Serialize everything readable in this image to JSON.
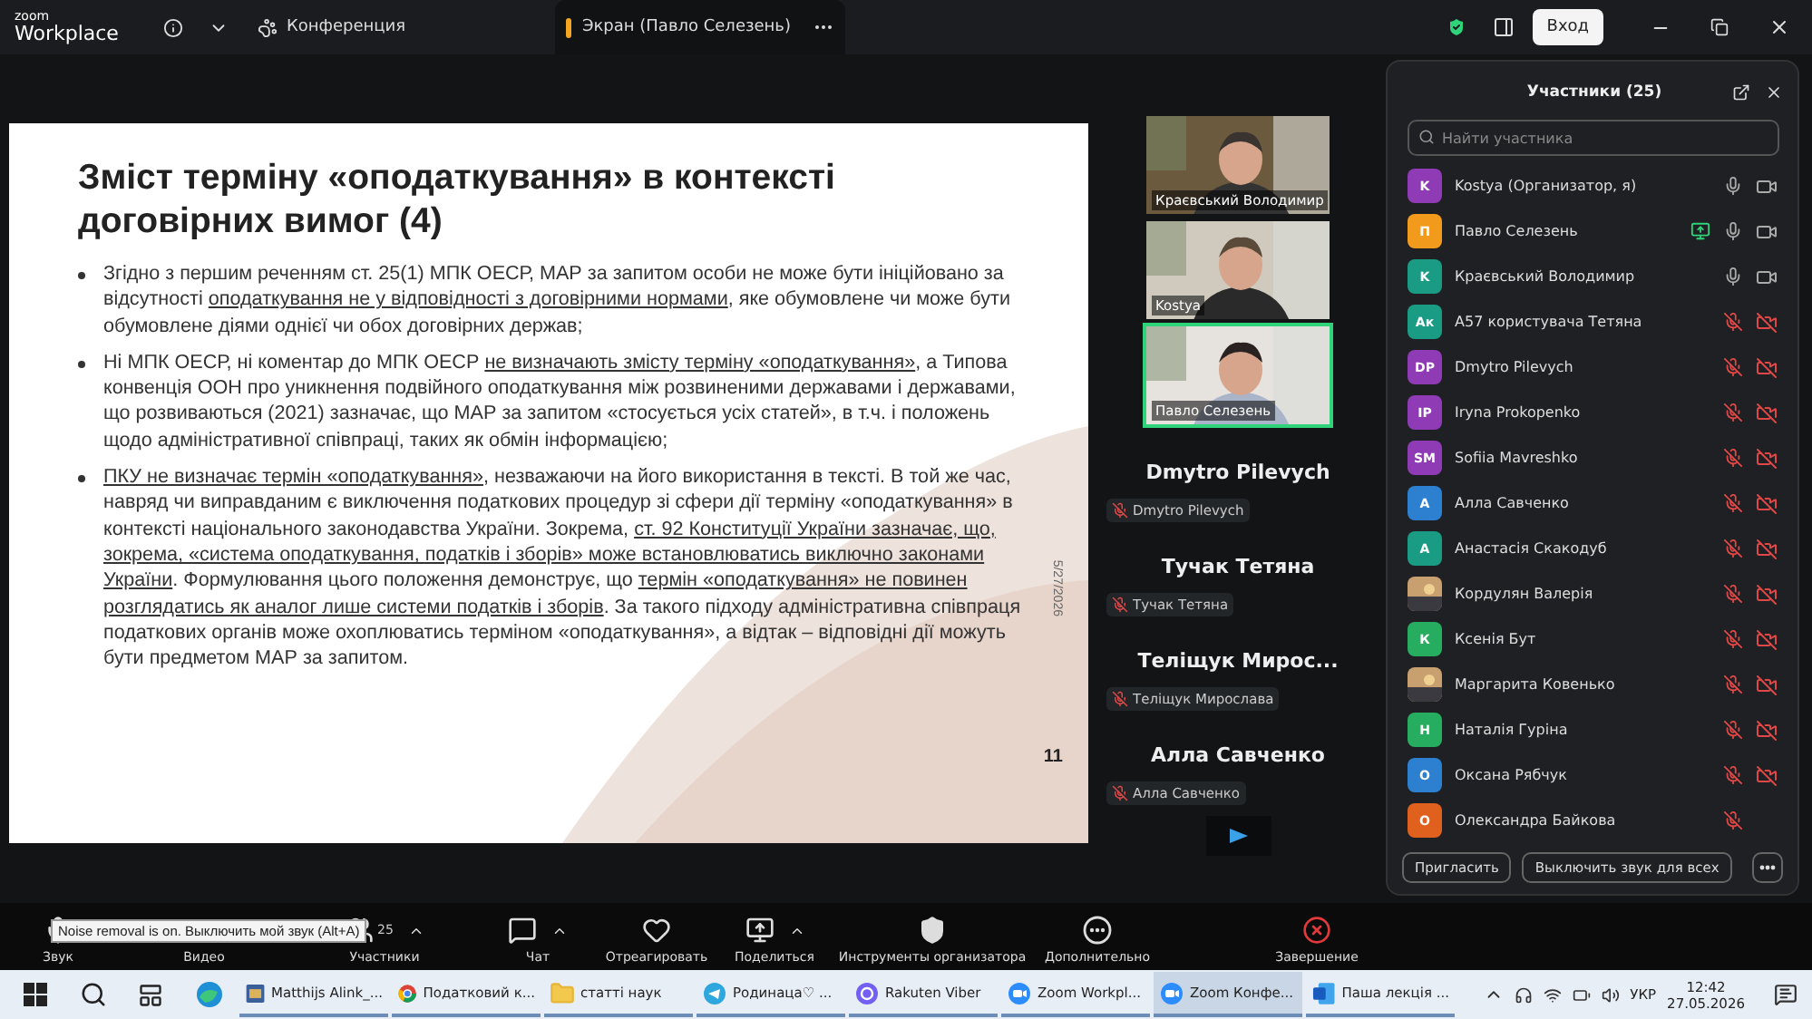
{
  "top_bar": {
    "logo_top": "zoom",
    "logo_bottom": "Workplace",
    "meeting_label": "Конференция",
    "share_tab": "Экран (Павло Селезень)",
    "login_button": "Вход"
  },
  "slide": {
    "title": "Зміст терміну «оподаткування» в контексті договірних вимог (4)",
    "bullets": [
      [
        {
          "text": "Згідно з першим реченням ст. 25(1) МПК ОЕСР, МАР за запитом особи не може бути ініційовано за відсутності ",
          "underlined": false
        },
        {
          "text": "оподаткування не у відповідності з договірними нормами",
          "underlined": true
        },
        {
          "text": ", яке обумовлене чи може бути обумовлене діями однієї чи обох договірних держав;",
          "underlined": false
        }
      ],
      [
        {
          "text": "Ні МПК ОЕСР, ні коментар до МПК ОЕСР ",
          "underlined": false
        },
        {
          "text": "не визначають змісту терміну «оподаткування»",
          "underlined": true
        },
        {
          "text": ", а Типова конвенція ООН про уникнення подвійного оподаткування між розвиненими державами і державами, що розвиваються (2021) зазначає, що МАР за запитом «стосується усіх статей», в т.ч. і положень щодо адміністративної співпраці, таких як обмін інформацією;",
          "underlined": false
        }
      ],
      [
        {
          "text": "ПКУ не визначає термін «оподаткування»",
          "underlined": true
        },
        {
          "text": ", незважаючи на його використання в тексті. В той же час, навряд чи виправданим є виключення податкових процедур зі сфери дії терміну «оподаткування» в контексті національного законодавства України. Зокрема, ",
          "underlined": false
        },
        {
          "text": "ст. 92 Конституції України зазначає, що, зокрема, «система оподаткування, податків і зборів» може встановлюватись виключно законами України",
          "underlined": true
        },
        {
          "text": ". Формулювання цього положення демонструє, що ",
          "underlined": false
        },
        {
          "text": "термін «оподаткування» не повинен розглядатись як аналог лише системи податків і зборів",
          "underlined": true
        },
        {
          "text": ". За такого підходу адміністративна співпраця податкових органів може охоплюватись терміном «оподаткування», а відтак – відповідні дії можуть бути предметом МАР за запитом.",
          "underlined": false
        }
      ]
    ],
    "side_date": "5/27/2026",
    "page_number": "11"
  },
  "video_tiles": [
    {
      "name": "Краєвський Володимир",
      "speaking": false
    },
    {
      "name": "Kostya",
      "speaking": false
    },
    {
      "name": "Павло Селезень",
      "speaking": true
    }
  ],
  "name_cards": [
    {
      "title": "Dmytro Pilevych",
      "tag": "Dmytro Pilevych"
    },
    {
      "title": "Тучак Тетяна",
      "tag": "Тучак Тетяна"
    },
    {
      "title": "Теліщук  Мирос...",
      "tag": "Теліщук Мирослава"
    },
    {
      "title": "Алла Савченко",
      "tag": "Алла Савченко"
    }
  ],
  "participants": {
    "title": "Участники (25)",
    "search": {
      "placeholder": "Найти участника"
    },
    "rows": [
      {
        "initials": "K",
        "name": "Kostya (Организатор, я)",
        "color": "#8e3bb5",
        "kind": "letter",
        "sharing": false,
        "muted": false,
        "video_shown": true,
        "video_muted": false
      },
      {
        "initials": "П",
        "name": "Павло Селезень",
        "color": "#f29a1c",
        "kind": "letter",
        "sharing": true,
        "muted": false,
        "video_shown": true,
        "video_muted": false
      },
      {
        "initials": "K",
        "name": "Краєвський Володимир",
        "color": "#1a9c84",
        "kind": "letter",
        "sharing": false,
        "muted": false,
        "video_shown": true,
        "video_muted": false
      },
      {
        "initials": "Ак",
        "name": "А57 користувача Тетяна",
        "color": "#1a9c84",
        "kind": "letter",
        "sharing": false,
        "muted": true,
        "video_shown": true,
        "video_muted": true
      },
      {
        "initials": "DP",
        "name": "Dmytro Pilevych",
        "color": "#8e3bb5",
        "kind": "letter",
        "sharing": false,
        "muted": true,
        "video_shown": true,
        "video_muted": true
      },
      {
        "initials": "IP",
        "name": "Iryna Prokopenko",
        "color": "#8e3bb5",
        "kind": "letter",
        "sharing": false,
        "muted": true,
        "video_shown": true,
        "video_muted": true
      },
      {
        "initials": "SM",
        "name": "Sofiia Mavreshko",
        "color": "#8e3bb5",
        "kind": "letter",
        "sharing": false,
        "muted": true,
        "video_shown": true,
        "video_muted": true
      },
      {
        "initials": "А",
        "name": "Алла Савченко",
        "color": "#2d7fd0",
        "kind": "letter",
        "sharing": false,
        "muted": true,
        "video_shown": true,
        "video_muted": true
      },
      {
        "initials": "А",
        "name": "Анастасія Скакодуб",
        "color": "#1a9c84",
        "kind": "letter",
        "sharing": false,
        "muted": true,
        "video_shown": true,
        "video_muted": true
      },
      {
        "name": "Кордулян Валерія",
        "kind": "picture",
        "sharing": false,
        "muted": true,
        "video_shown": true,
        "video_muted": true
      },
      {
        "initials": "К",
        "name": "Ксенія Бут",
        "color": "#27ad5f",
        "kind": "letter",
        "sharing": false,
        "muted": true,
        "video_shown": true,
        "video_muted": true
      },
      {
        "name": "Маргарита Ковенько",
        "kind": "picture",
        "sharing": false,
        "muted": true,
        "video_shown": true,
        "video_muted": true
      },
      {
        "initials": "Н",
        "name": "Наталія Гуріна",
        "color": "#27ad5f",
        "kind": "letter",
        "sharing": false,
        "muted": true,
        "video_shown": true,
        "video_muted": true
      },
      {
        "initials": "О",
        "name": "Оксана Рябчук",
        "color": "#2d7fd0",
        "kind": "letter",
        "sharing": false,
        "muted": true,
        "video_shown": true,
        "video_muted": true
      },
      {
        "initials": "О",
        "name": "Олександра Байкова",
        "color": "#e0611e",
        "kind": "letter",
        "sharing": false,
        "muted": true,
        "video_shown": false
      }
    ],
    "buttons": [
      "Пригласить",
      "Выключить звук для всех"
    ]
  },
  "toolbar": {
    "tooltip": "Noise removal is on. Выключить мой звук (Alt+A)",
    "items": [
      {
        "kind": "audio",
        "label": "Звук",
        "caret": false
      },
      {
        "kind": "video",
        "label": "Видео",
        "caret": false
      },
      {
        "kind": "participants",
        "label": "Участники",
        "count": "25",
        "caret": true
      },
      {
        "kind": "chat",
        "label": "Чат",
        "caret": true
      },
      {
        "kind": "react",
        "label": "Отреагировать",
        "caret": false
      },
      {
        "kind": "share",
        "label": "Поделиться",
        "caret": true
      },
      {
        "kind": "host",
        "label": "Инструменты организатора",
        "caret": false
      },
      {
        "kind": "more",
        "label": "Дополнительно",
        "caret": false
      },
      {
        "kind": "end",
        "label": "Завершение",
        "caret": false
      }
    ]
  },
  "taskbar": {
    "apps": [
      {
        "kind": "doc",
        "label": "Matthijs Alink_...",
        "selected": false
      },
      {
        "kind": "chrome",
        "label": "Податковий к...",
        "selected": false
      },
      {
        "kind": "folder",
        "label": "статті наук",
        "selected": false
      },
      {
        "kind": "telegram",
        "label": "Родинаца♡ ...",
        "selected": false
      },
      {
        "kind": "viber",
        "label": "Rakuten Viber",
        "selected": false
      },
      {
        "kind": "zoom",
        "label": "Zoom Workpl...",
        "selected": false
      },
      {
        "kind": "zoom",
        "label": "Zoom Конфе...",
        "selected": true
      },
      {
        "kind": "word",
        "label": "Паша лекція ...",
        "selected": false
      }
    ],
    "language": "УКР",
    "time": "12:42",
    "date": "27.05.2026"
  }
}
